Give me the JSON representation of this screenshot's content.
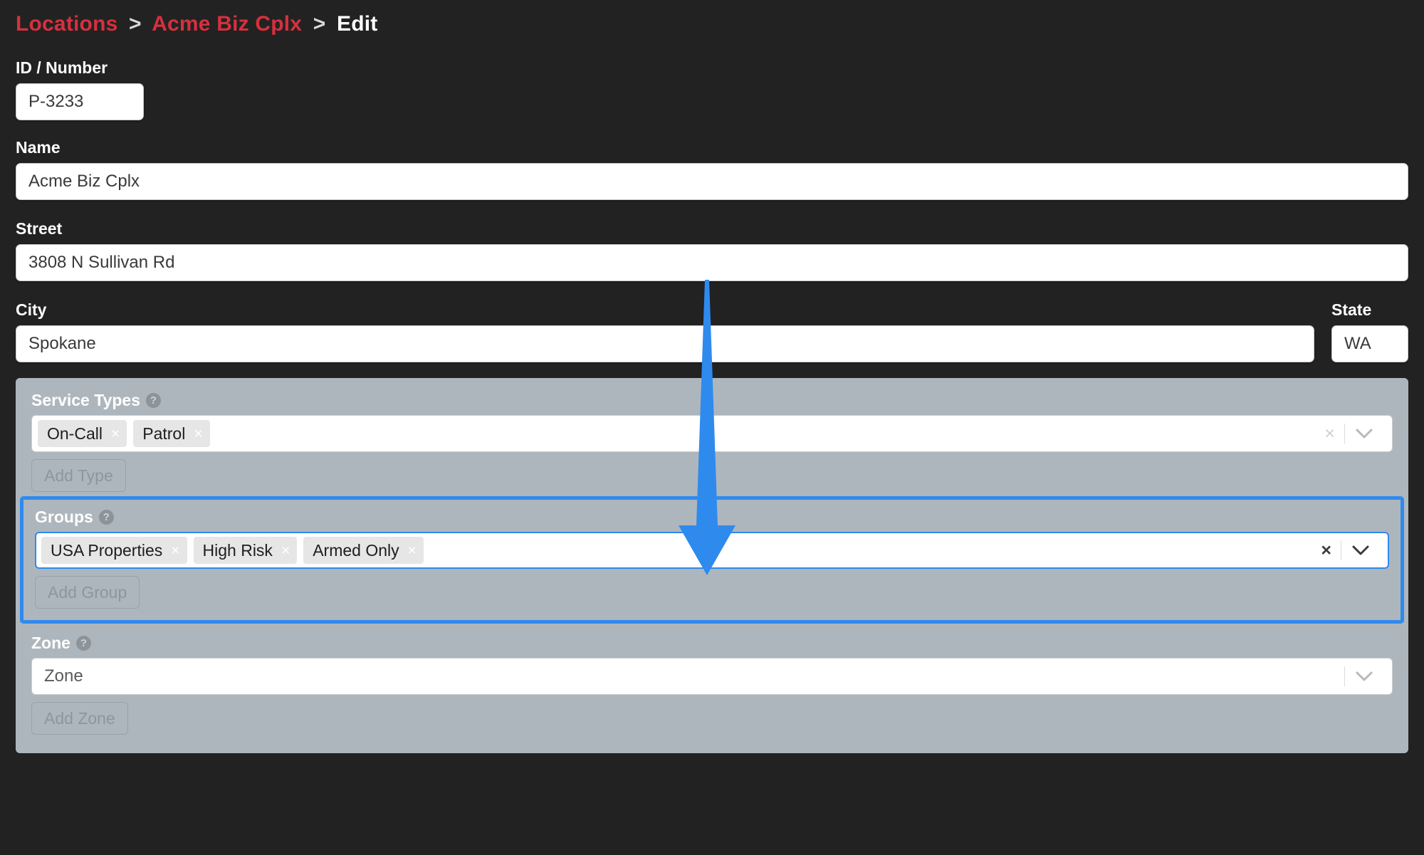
{
  "breadcrumb": {
    "items": [
      {
        "label": "Locations",
        "type": "link"
      },
      {
        "label": "Acme Biz Cplx",
        "type": "link"
      },
      {
        "label": "Edit",
        "type": "current"
      }
    ],
    "separator": ">"
  },
  "colors": {
    "background": "#222222",
    "breadcrumb_link": "#d6303e",
    "panel": "#aeb6bd",
    "highlight": "#2f8aee",
    "arrow": "#2f8aee"
  },
  "form": {
    "id_number": {
      "label": "ID / Number",
      "value": "P-3233"
    },
    "name": {
      "label": "Name",
      "value": "Acme Biz Cplx"
    },
    "street": {
      "label": "Street",
      "value": "3808 N Sullivan Rd"
    },
    "city": {
      "label": "City",
      "value": "Spokane"
    },
    "state": {
      "label": "State",
      "value": "WA"
    }
  },
  "panel": {
    "service_types": {
      "label": "Service Types",
      "help_icon": "question-mark-icon",
      "chips": [
        "On-Call",
        "Patrol"
      ],
      "chip_remove_glyph": "×",
      "clear_glyph": "×",
      "caret_icon": "chevron-down-icon",
      "add_button": "Add Type"
    },
    "groups": {
      "label": "Groups",
      "help_icon": "question-mark-icon",
      "chips": [
        "USA Properties",
        "High Risk",
        "Armed Only"
      ],
      "chip_remove_glyph": "×",
      "clear_glyph": "×",
      "caret_icon": "chevron-down-icon",
      "add_button": "Add Group",
      "highlighted": true
    },
    "zone": {
      "label": "Zone",
      "help_icon": "question-mark-icon",
      "placeholder": "Zone",
      "value": "",
      "caret_icon": "chevron-down-icon",
      "add_button": "Add Zone"
    }
  },
  "annotation": {
    "arrow": {
      "icon": "down-arrow-annotation",
      "points_to": "Groups"
    }
  }
}
